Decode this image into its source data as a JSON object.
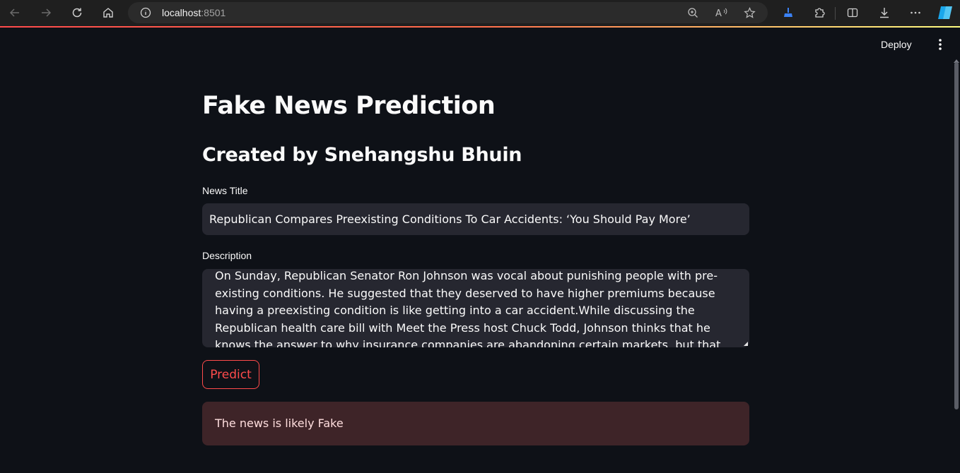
{
  "browser": {
    "url_host": "localhost",
    "url_port": ":8501"
  },
  "toolbar": {
    "deploy_label": "Deploy"
  },
  "page": {
    "title": "Fake News Prediction",
    "subtitle": "Created by Snehangshu Bhuin"
  },
  "form": {
    "news_title_label": "News Title",
    "news_title_value": "Republican Compares Preexisting Conditions To Car Accidents: ‘You Should Pay More’",
    "description_label": "Description",
    "description_value": "On Sunday, Republican Senator Ron Johnson was vocal about punishing people with pre-existing conditions. He suggested that they deserved to have higher premiums because having a preexisting condition is like getting into a car accident.While discussing the Republican health care bill with Meet the Press host Chuck Todd, Johnson thinks that he knows the answer to why insurance companies are abandoning certain markets, but that, nobody wants to talk about it. The Republican",
    "predict_label": "Predict"
  },
  "result": {
    "message": "The news is likely Fake"
  },
  "colors": {
    "background": "#0e1117",
    "input_bg": "#262730",
    "accent": "#ff4b4b",
    "error_bg": "#3e2428"
  }
}
